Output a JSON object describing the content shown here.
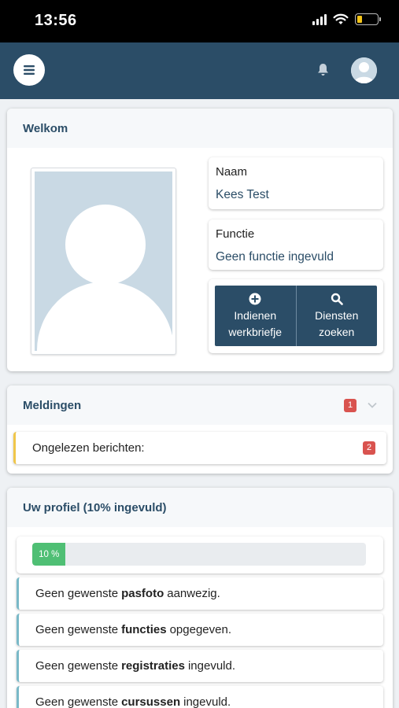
{
  "status_bar": {
    "time": "13:56"
  },
  "header": {
    "menu_icon": "hamburger-icon",
    "notification_icon": "bell-icon",
    "avatar_icon": "user-avatar-icon",
    "color": "#2b4d67"
  },
  "welcome": {
    "title": "Welkom",
    "name_label": "Naam",
    "name_value": "Kees Test",
    "function_label": "Functie",
    "function_value": "Geen functie ingevuld",
    "actions": [
      {
        "icon": "plus-circle-icon",
        "label": "Indienen werkbriefje"
      },
      {
        "icon": "search-icon",
        "label": "Diensten zoeken"
      }
    ]
  },
  "notifications": {
    "title": "Meldingen",
    "badge_count": "1",
    "items": [
      {
        "label": "Ongelezen berichten:",
        "count": "2"
      }
    ]
  },
  "profile": {
    "title": "Uw profiel (10% ingevuld)",
    "progress_percent": 10,
    "progress_label": "10 %",
    "tasks": [
      {
        "prefix": "Geen gewenste",
        "bold": "pasfoto",
        "suffix": "aanwezig."
      },
      {
        "prefix": "Geen gewenste",
        "bold": "functies",
        "suffix": "opgegeven."
      },
      {
        "prefix": "Geen gewenste",
        "bold": "registraties",
        "suffix": "ingevuld."
      },
      {
        "prefix": "Geen gewenste",
        "bold": "cursussen",
        "suffix": "ingevuld."
      }
    ]
  }
}
